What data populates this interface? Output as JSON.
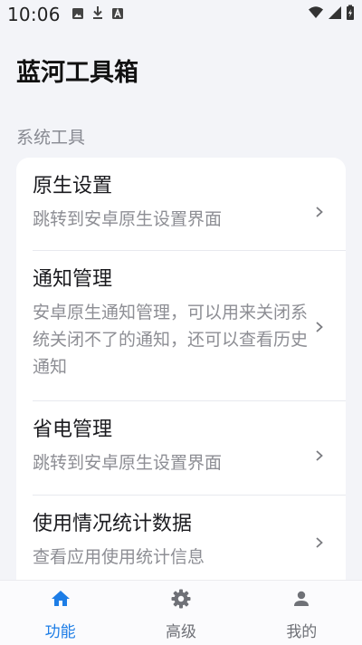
{
  "status_bar": {
    "time": "10:06",
    "left_icons": [
      "image-icon",
      "download-icon",
      "text-a-icon"
    ],
    "right_icons": [
      "wifi-icon",
      "signal-icon",
      "battery-icon"
    ]
  },
  "app": {
    "title": "蓝河工具箱"
  },
  "section": {
    "title": "系统工具"
  },
  "items": [
    {
      "title": "原生设置",
      "desc": "跳转到安卓原生设置界面"
    },
    {
      "title": "通知管理",
      "desc": "安卓原生通知管理，可以用来关闭系统关闭不了的通知，还可以查看历史通知"
    },
    {
      "title": "省电管理",
      "desc": "跳转到安卓原生设置界面"
    },
    {
      "title": "使用情况统计数据",
      "desc": "查看应用使用统计信息"
    }
  ],
  "bottom_nav": {
    "active": 0,
    "items": [
      {
        "label": "功能",
        "icon": "home-icon"
      },
      {
        "label": "高级",
        "icon": "gear-icon"
      },
      {
        "label": "我的",
        "icon": "person-icon"
      }
    ]
  },
  "colors": {
    "background": "#f3f4f8",
    "card": "#ffffff",
    "accent": "#1d7de6",
    "inactive": "#6f7177",
    "secondary_text": "#8d8e94"
  }
}
